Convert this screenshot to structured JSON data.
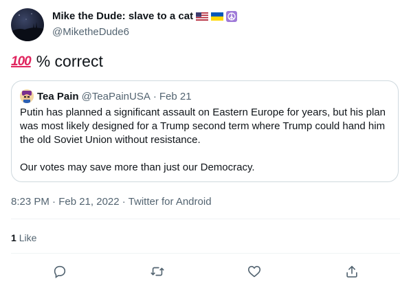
{
  "author": {
    "display_name": "Mike the Dude: slave to a cat",
    "handle": "@MiketheDude6"
  },
  "tweet": {
    "emoji_label": "100",
    "text": "% correct"
  },
  "quoted": {
    "name": "Tea Pain",
    "handle": "@TeaPainUSA",
    "separator": "·",
    "date": "Feb 21",
    "paragraph1": "Putin has planned a significant assault on Eastern Europe for years, but his plan was most likely designed for a Trump second term where Trump could hand him the old Soviet Union without resistance.",
    "paragraph2": "Our votes may save more than just our Democracy."
  },
  "meta": {
    "timestamp": "8:23 PM · Feb 21, 2022 · Twitter for Android"
  },
  "stats": {
    "likes_count": "1",
    "likes_label": "Like"
  },
  "actions": {
    "reply_icon": "reply-icon",
    "retweet_icon": "retweet-icon",
    "like_icon": "heart-icon",
    "share_icon": "share-icon"
  },
  "colors": {
    "text_primary": "#0f1419",
    "text_secondary": "#536471",
    "border": "#cfd9de",
    "emoji_red": "#e0245e"
  }
}
